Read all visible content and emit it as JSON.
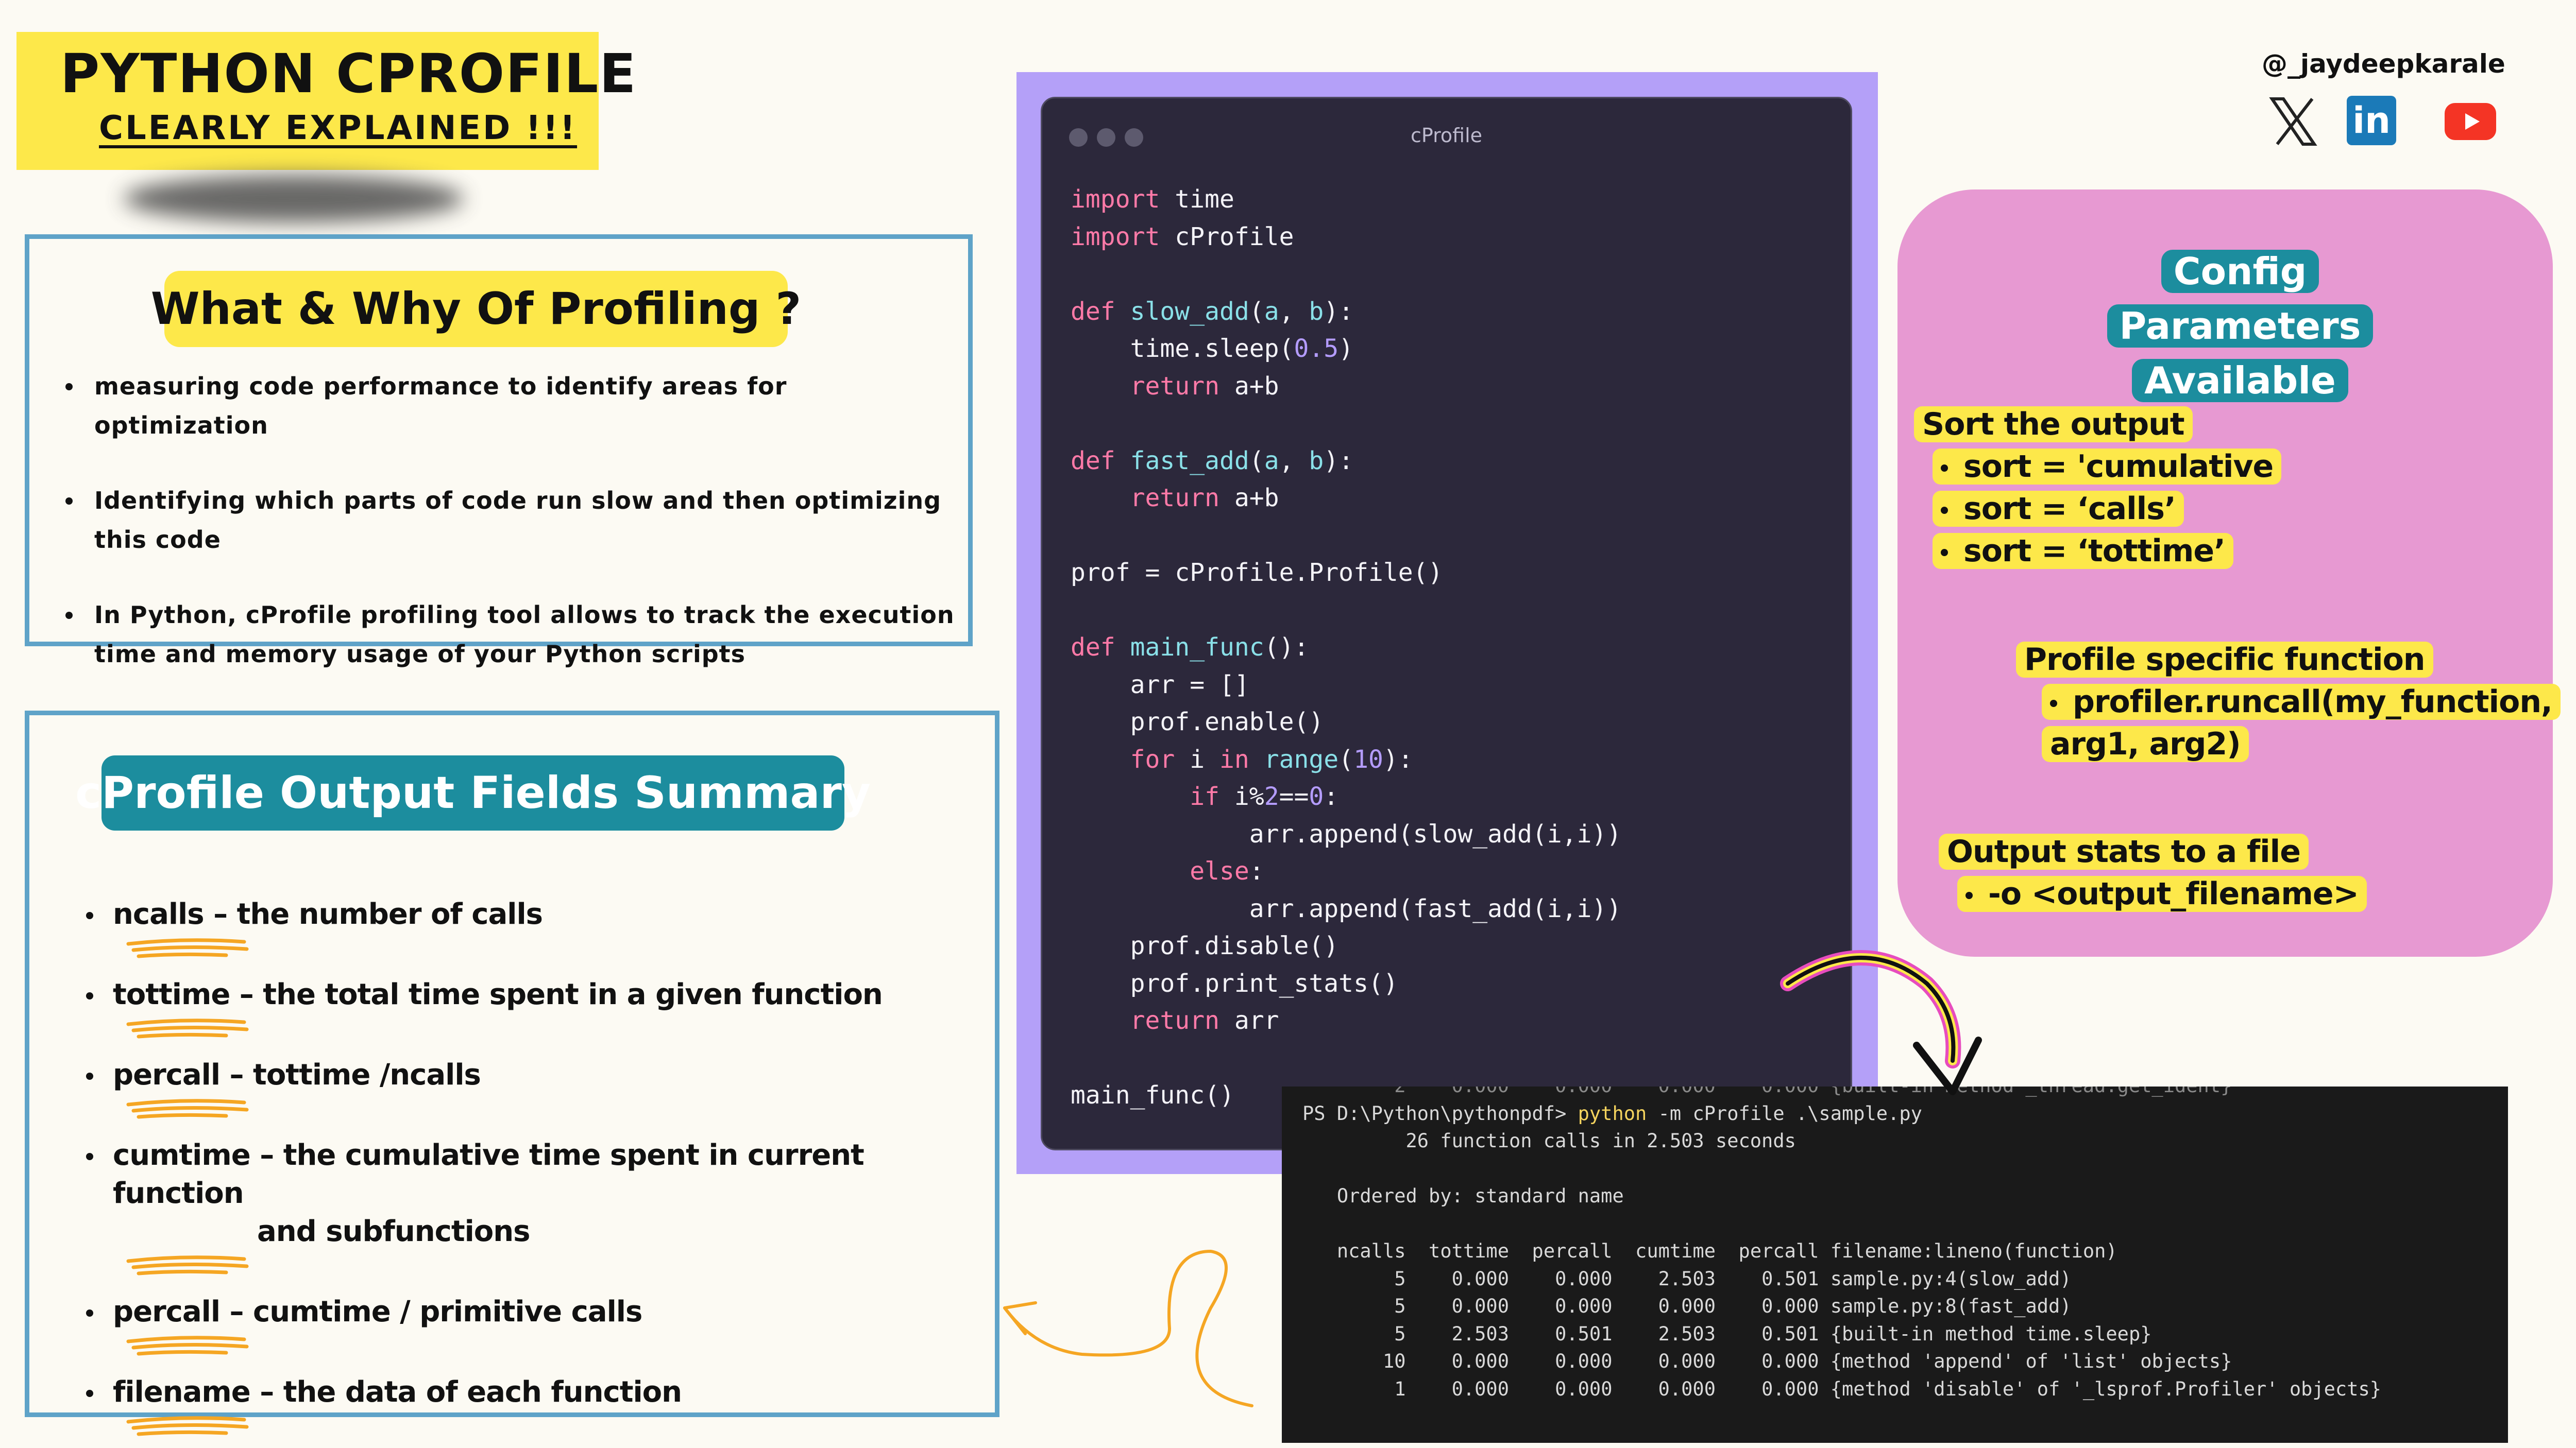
{
  "title": {
    "main": "PYTHON CPROFILE",
    "sub": "CLEARLY EXPLAINED !!!"
  },
  "why_panel": {
    "heading": "What & Why Of Profiling  ?",
    "bullets": [
      "measuring code performance to identify areas for optimization",
      "Identifying which parts of code run slow and then optimizing this code",
      "In Python, cProfile profiling tool allows to track the execution time and memory usage of your Python scripts"
    ]
  },
  "fields_panel": {
    "heading": "cProfile Output Fields  Summary",
    "items": [
      "ncalls – the number of calls",
      "tottime – the total time spent in a given function",
      "percall – tottime /ncalls",
      "cumtime – the cumulative time spent in current function",
      "and subfunctions",
      "percall –  cumtime / primitive calls",
      "filename – the data of each function"
    ]
  },
  "code_window": {
    "title": "cProfile"
  },
  "terminal": {
    "prompt": "PS D:\\Python\\pythonpdf> ",
    "command": "python",
    "args": " -m cProfile .\\sample.py",
    "summary": "26 function calls in 2.503 seconds",
    "ordered_by": "Ordered by: standard name",
    "columns": [
      "ncalls",
      "tottime",
      "percall",
      "cumtime",
      "percall",
      "filename:lineno(function)"
    ],
    "rows": [
      [
        "5",
        "0.000",
        "0.000",
        "2.503",
        "0.501",
        "sample.py:4(slow_add)"
      ],
      [
        "5",
        "0.000",
        "0.000",
        "0.000",
        "0.000",
        "sample.py:8(fast_add)"
      ],
      [
        "5",
        "2.503",
        "0.501",
        "2.503",
        "0.501",
        "{built-in method time.sleep}"
      ],
      [
        "10",
        "0.000",
        "0.000",
        "0.000",
        "0.000",
        "{method 'append' of 'list' objects}"
      ],
      [
        "1",
        "0.000",
        "0.000",
        "0.000",
        "0.000",
        "{method 'disable' of '_lsprof.Profiler' objects}"
      ]
    ]
  },
  "social": {
    "handle": "@_jaydeepkarale",
    "icons": [
      "x-icon",
      "linkedin-icon",
      "youtube-icon"
    ]
  },
  "config_panel": {
    "heading_line1": "Config Parameters",
    "heading_line2": "Available",
    "sort_heading": "Sort the output",
    "sort_items": [
      "sort = 'cumulative",
      "sort  = ‘calls’",
      "sort = ‘tottime’"
    ],
    "profile_heading": "Profile specific function",
    "profile_item_line1": "profiler.runcall(my_function,",
    "profile_item_line2": "arg1, arg2)",
    "output_heading": "Output stats to a file",
    "output_item": "-o <output_filename>"
  },
  "colors": {
    "background": "#fcfaf3",
    "yellow": "#fde84a",
    "teal": "#1c8d9e",
    "panel_border": "#5fa3c8",
    "config_bg": "#e799d2",
    "code_frame": "#b4a0f8",
    "code_bg": "#2c283b",
    "terminal_bg": "#1a1a1a",
    "keyword": "#ff7aa8",
    "function": "#8ae0e8",
    "number": "#b49cff"
  }
}
